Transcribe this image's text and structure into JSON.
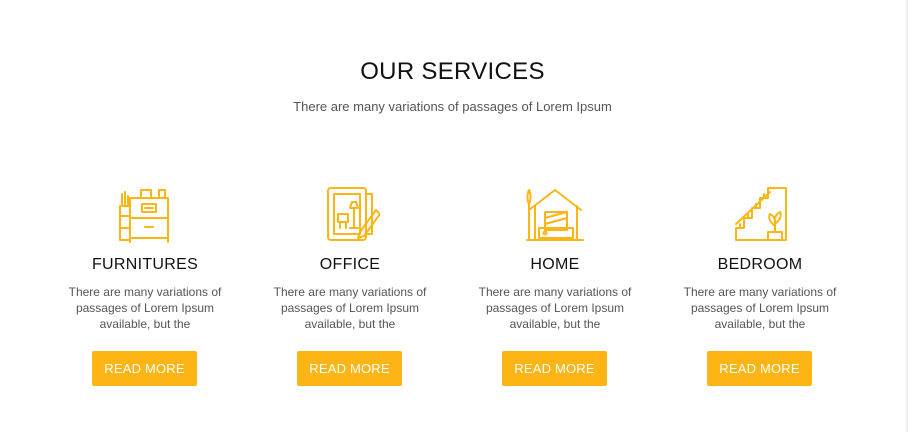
{
  "section": {
    "title": "OUR SERVICES",
    "subtitle": "There are many variations of passages of Lorem Ipsum"
  },
  "services": [
    {
      "title": "FURNITURES",
      "text": "There are many variations of passages of Lorem Ipsum available, but the",
      "button": "READ MORE",
      "icon": "furniture-cabinet-icon"
    },
    {
      "title": "OFFICE",
      "text": "There are many variations of passages of Lorem Ipsum available, but the",
      "button": "READ MORE",
      "icon": "office-blueprint-icon"
    },
    {
      "title": "HOME",
      "text": "There are many variations of passages of Lorem Ipsum available, but the",
      "button": "READ MORE",
      "icon": "home-house-icon"
    },
    {
      "title": "BEDROOM",
      "text": "There are many variations of passages of Lorem Ipsum available, but the",
      "button": "READ MORE",
      "icon": "bedroom-stairs-plant-icon"
    }
  ],
  "colors": {
    "accent": "#fdb515",
    "heading": "#111111",
    "body_text": "#555555"
  }
}
